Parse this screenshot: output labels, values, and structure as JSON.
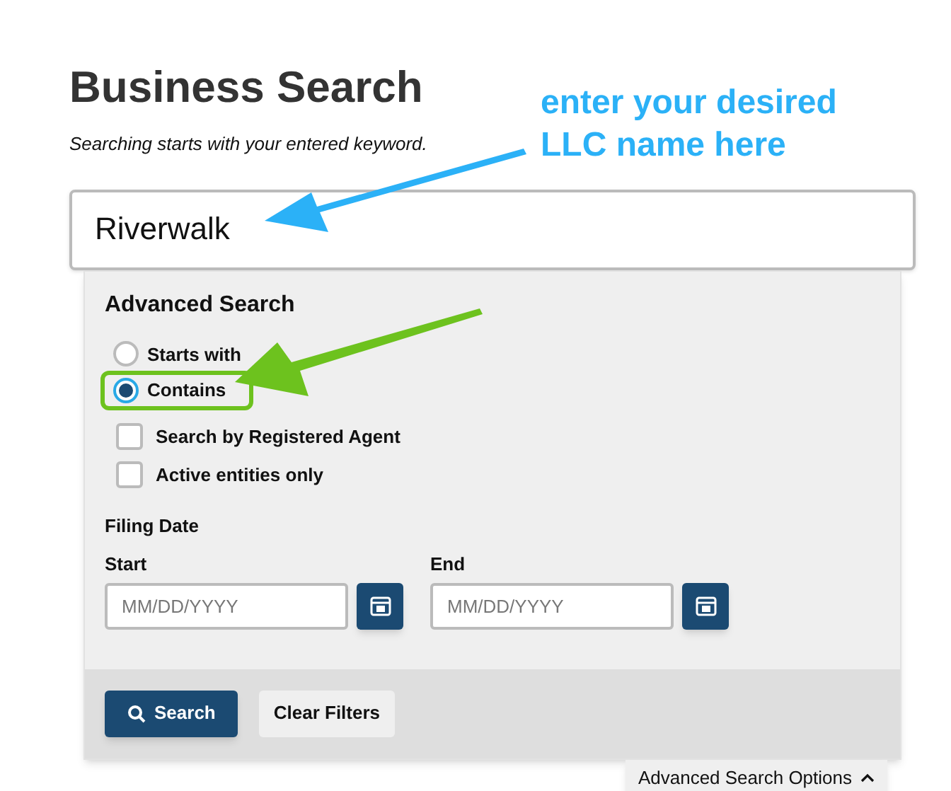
{
  "heading": "Business Search",
  "subtitle": "Searching starts with your entered keyword.",
  "search": {
    "value": "Riverwalk"
  },
  "advanced": {
    "title": "Advanced Search",
    "match_options": [
      {
        "label": "Starts with",
        "selected": false,
        "highlighted": false
      },
      {
        "label": "Contains",
        "selected": true,
        "highlighted": true
      }
    ],
    "filters": [
      {
        "label": "Search by Registered Agent",
        "checked": false
      },
      {
        "label": "Active entities only",
        "checked": false
      }
    ],
    "filing_date": {
      "title": "Filing Date",
      "fields": [
        {
          "label": "Start",
          "placeholder": "MM/DD/YYYY"
        },
        {
          "label": "End",
          "placeholder": "MM/DD/YYYY"
        }
      ]
    },
    "buttons": [
      {
        "kind": "primary",
        "label": "Search"
      },
      {
        "kind": "secondary",
        "label": "Clear Filters"
      }
    ]
  },
  "options_toggle": {
    "label": "Advanced Search Options",
    "expanded": true
  },
  "annotation": {
    "lines": [
      "enter your desired",
      "LLC name here"
    ]
  }
}
